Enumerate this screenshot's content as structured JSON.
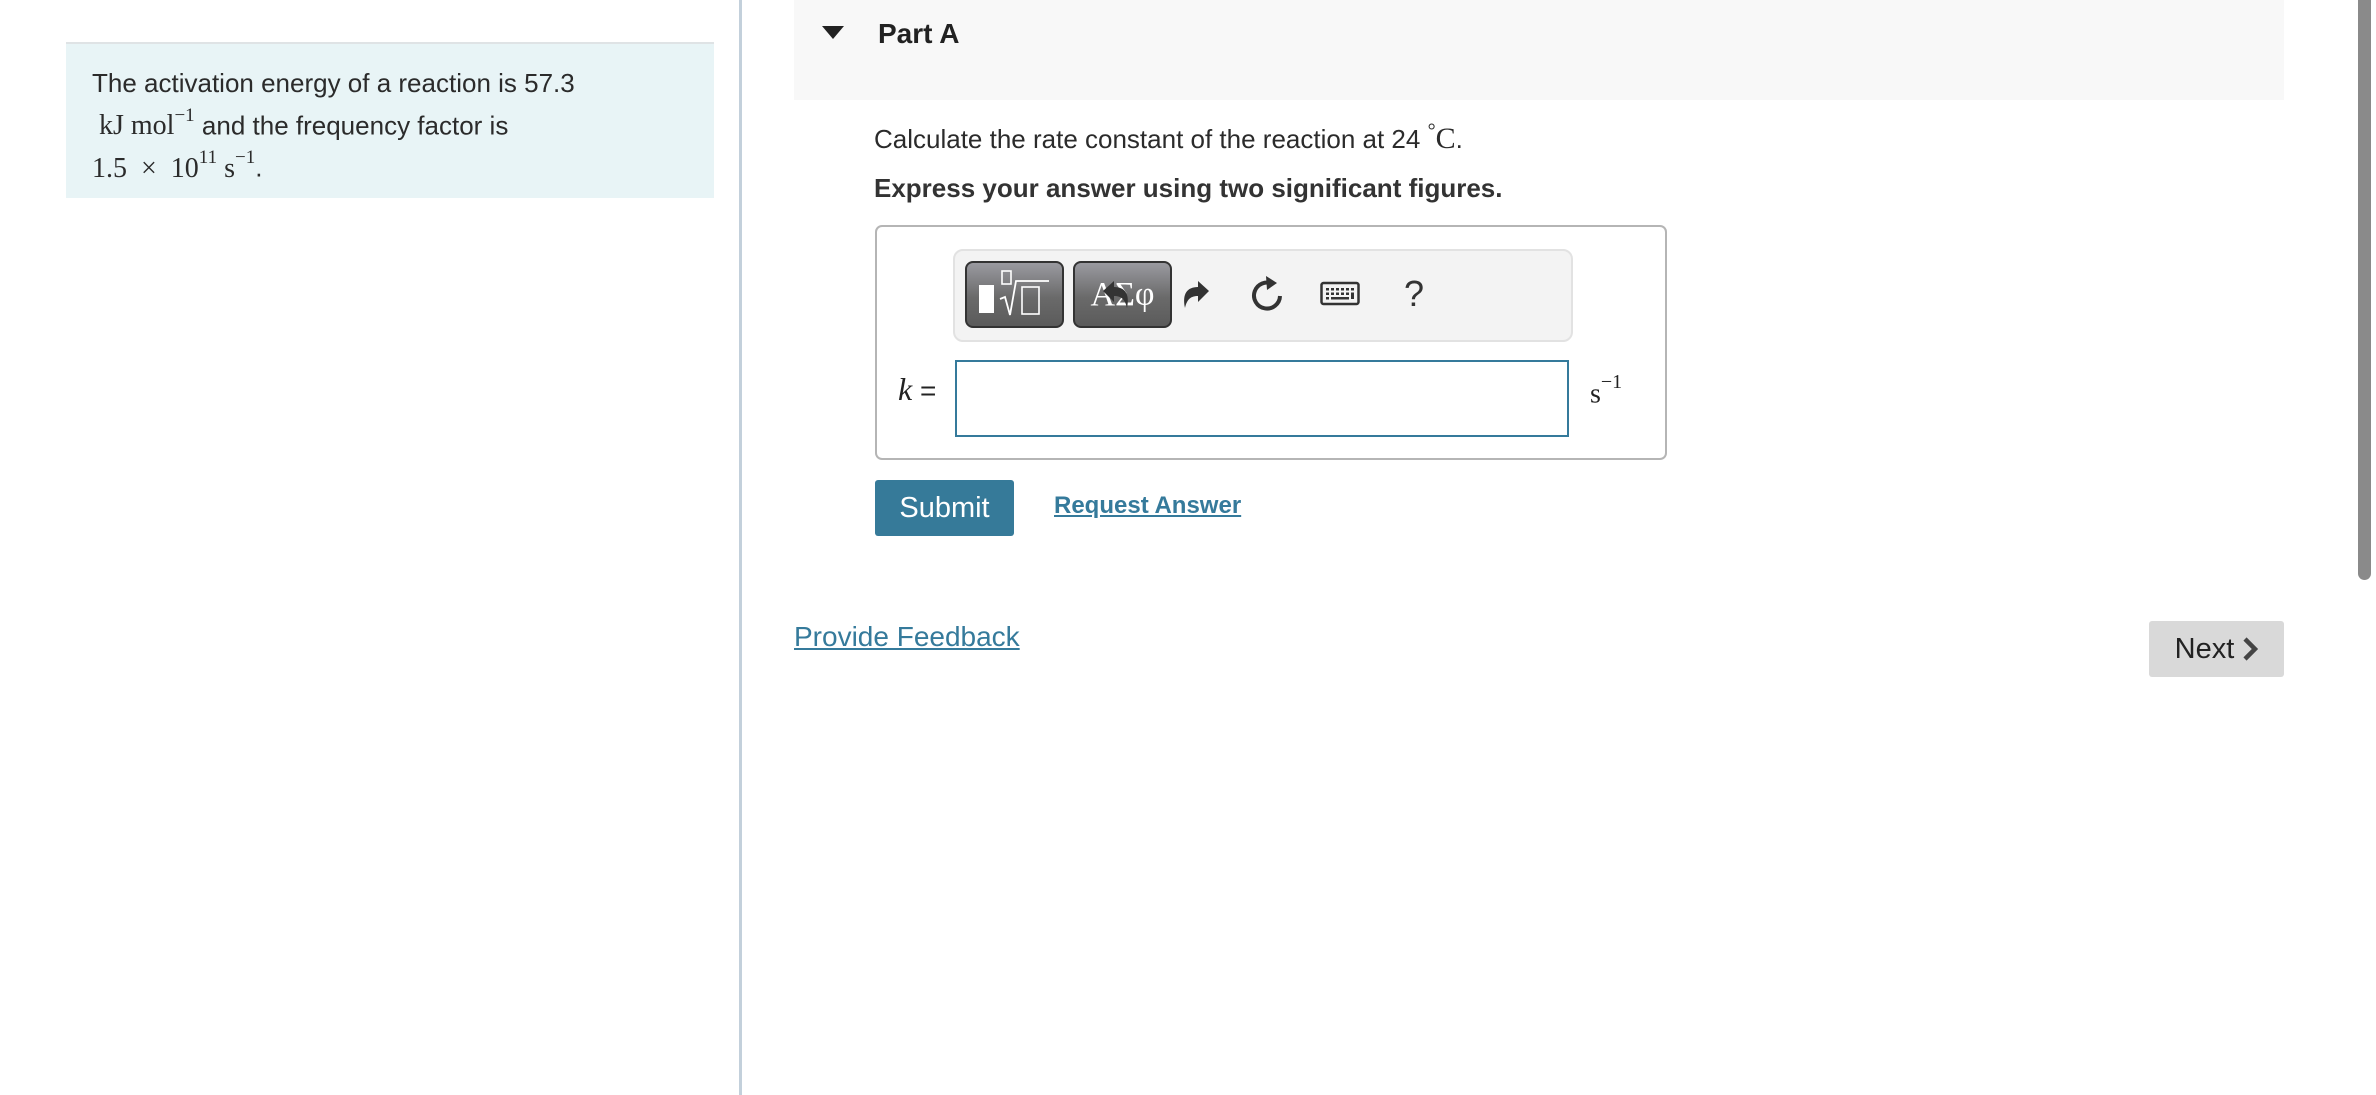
{
  "problem": {
    "text_1": "The activation energy of a reaction is 57.3",
    "math_unit_energy": "kJ mol",
    "math_unit_energy_exp": "−1",
    "text_2": " and the frequency factor is",
    "math_factor_mantissa": "1.5",
    "math_times": "×",
    "math_factor_base": "10",
    "math_factor_exp": "11",
    "math_factor_unit": "s",
    "math_factor_unit_exp": "−1",
    "text_end": "."
  },
  "part": {
    "title": "Part A",
    "question_prefix": "Calculate the rate constant of the reaction at 24",
    "question_degree": "°",
    "question_unit": "C",
    "question_suffix": ".",
    "instruction": "Express your answer using two significant figures."
  },
  "answer": {
    "variable": "k",
    "equals": "=",
    "value": "",
    "unit": "s",
    "unit_exp": "−1",
    "toolbar": {
      "templates_label": "templates",
      "greek_label": "ΑΣφ",
      "undo": "undo-icon",
      "redo": "redo-icon",
      "reset": "reset-icon",
      "keyboard": "keyboard-icon",
      "help": "?"
    }
  },
  "actions": {
    "submit": "Submit",
    "request_answer": "Request Answer",
    "provide_feedback": "Provide Feedback",
    "next": "Next"
  },
  "colors": {
    "accent": "#357a9b",
    "submit_bg": "#367a99",
    "problem_bg": "#e8f4f6",
    "header_bg": "#f8f8f8",
    "next_bg": "#d9d9d9"
  }
}
